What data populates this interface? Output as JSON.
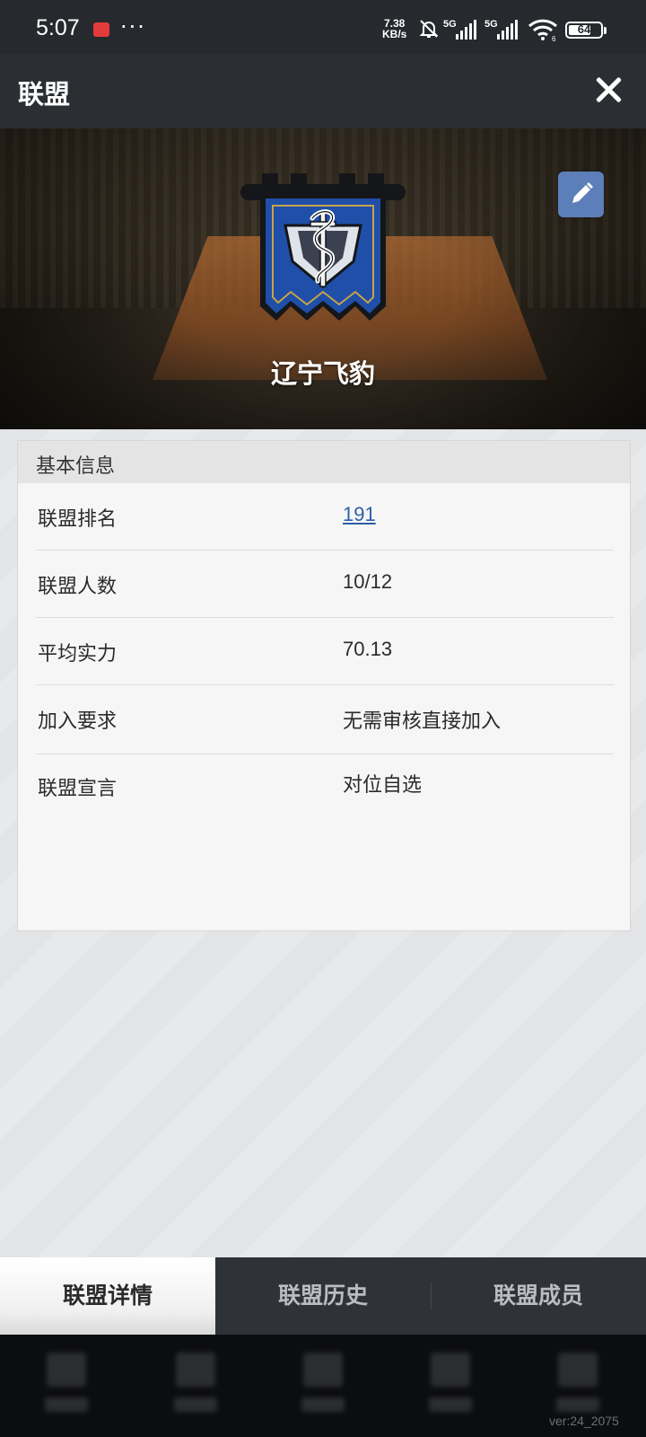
{
  "status_bar": {
    "time": "5:07",
    "dots": "···",
    "speed_value": "7.38",
    "speed_unit": "KB/s",
    "sim1_label": "5G",
    "sim2_label": "5G",
    "wifi_label": "6",
    "battery": "64"
  },
  "header": {
    "title": "联盟"
  },
  "banner": {
    "team_name": "辽宁飞豹"
  },
  "info": {
    "section_title": "基本信息",
    "rows": [
      {
        "label": "联盟排名",
        "value": "191"
      },
      {
        "label": "联盟人数",
        "value": "10/12"
      },
      {
        "label": "平均实力",
        "value": "70.13"
      },
      {
        "label": "加入要求",
        "value": "无需审核直接加入"
      },
      {
        "label": "联盟宣言",
        "value": "对位自选"
      }
    ]
  },
  "tabs": [
    {
      "label": "联盟详情",
      "active": true
    },
    {
      "label": "联盟历史",
      "active": false
    },
    {
      "label": "联盟成员",
      "active": false
    }
  ],
  "footer": {
    "version": "ver:24_2075"
  },
  "colors": {
    "link": "#2e5fa6",
    "edit_button": "#5d7fb9",
    "logo_blue": "#1f4fa8",
    "logo_gold": "#c8a24a"
  }
}
